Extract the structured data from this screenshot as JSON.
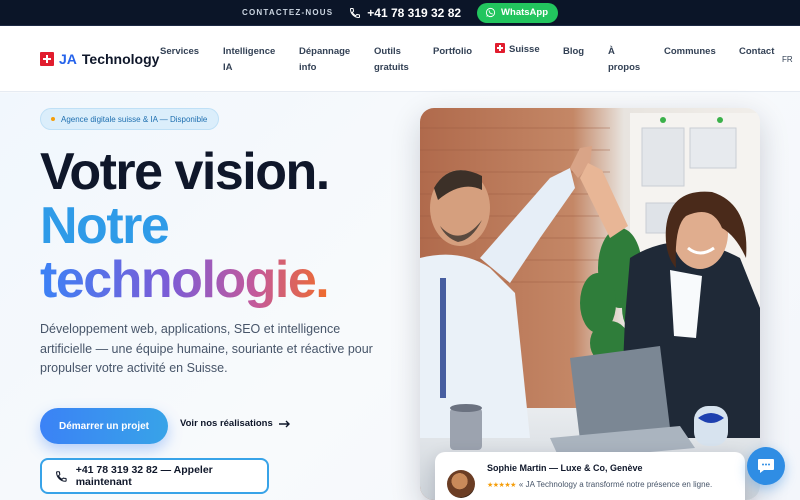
{
  "topbar": {
    "contact_label": "CONTACTEZ-NOUS",
    "phone": "+41 78 319 32 82",
    "whatsapp_label": "WhatsApp"
  },
  "brand": {
    "prefix": "JA",
    "name": "Technology"
  },
  "nav": {
    "items": [
      {
        "label": "Services"
      },
      {
        "label_line1": "Intelligence",
        "label_line2": "IA"
      },
      {
        "label_line1": "Dépannage",
        "label_line2": "info"
      },
      {
        "label_line1": "Outils",
        "label_line2": "gratuits"
      },
      {
        "label": "Portfolio"
      },
      {
        "label": "Suisse"
      },
      {
        "label": "Blog"
      },
      {
        "label_line1": "À",
        "label_line2": "propos"
      },
      {
        "label": "Communes"
      },
      {
        "label": "Contact"
      }
    ],
    "language": "FR"
  },
  "hero": {
    "badge": "Agence digitale suisse & IA — Disponible",
    "title_line1": "Votre vision.",
    "title_line2": "Notre",
    "title_line3": "technologie.",
    "lead": "Développement web, applications, SEO et intelligence artificielle — une équipe humaine, souriante et réactive pour propulser votre activité en Suisse.",
    "cta_primary": "Démarrer un projet",
    "cta_secondary": "Voir nos réalisations",
    "cta_call": "+41 78 319 32 82 — Appeler maintenant"
  },
  "testimonial": {
    "name": "Sophie Martin — Luxe & Co, Genève",
    "stars": "★★★★★",
    "quote": "« JA Technology a transformé notre présence en ligne."
  },
  "colors": {
    "accent": "#2f9be8",
    "primary": "#3b82f6",
    "dark": "#0b1528",
    "whatsapp": "#22c55e",
    "swiss_red": "#e11d2e"
  },
  "icons": {
    "phone": "phone-icon",
    "whatsapp": "whatsapp-icon",
    "arrow": "arrow-right-icon",
    "chat": "chat-icon",
    "flag": "swiss-flag-icon"
  }
}
